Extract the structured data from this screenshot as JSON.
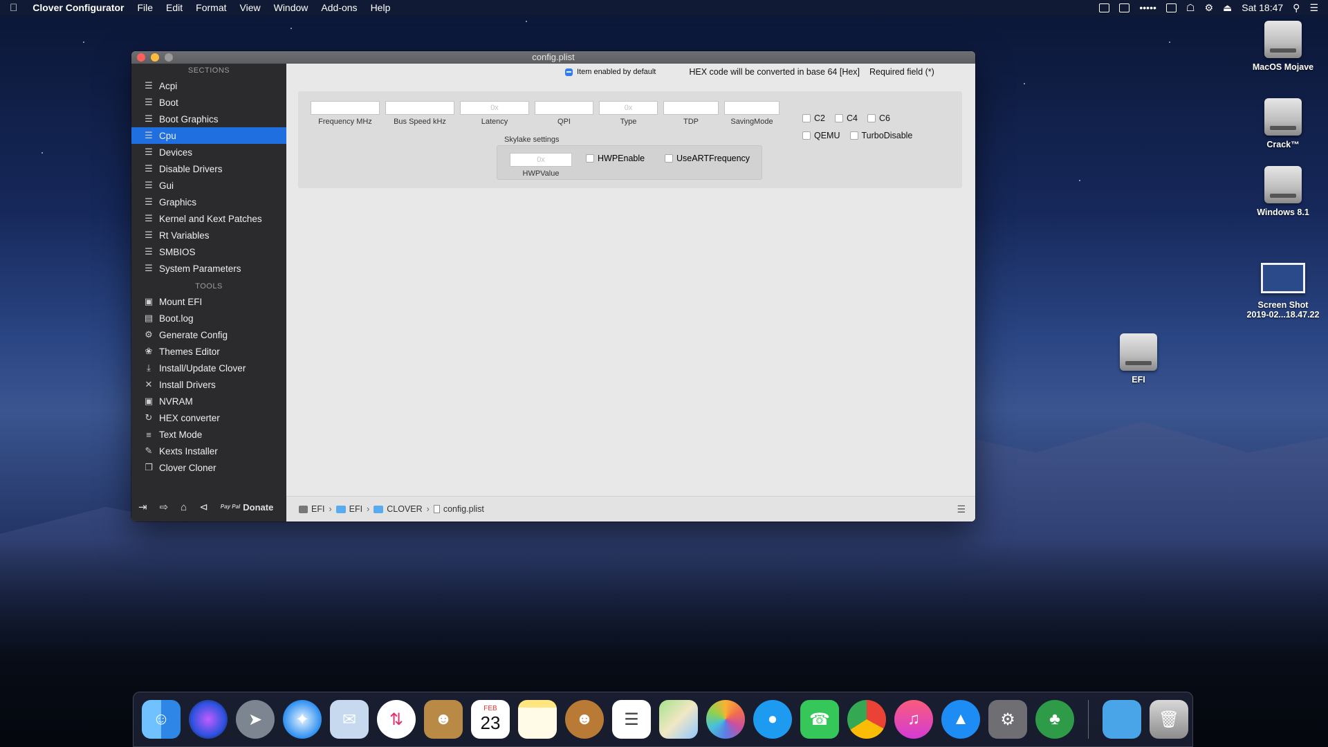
{
  "menubar": {
    "app_name": "Clover Configurator",
    "items": [
      "File",
      "Edit",
      "Format",
      "View",
      "Window",
      "Add-ons",
      "Help"
    ],
    "clock": "Sat 18:47",
    "dots": "•••••"
  },
  "window": {
    "title": "config.plist",
    "sidebar": {
      "sections_heading": "SECTIONS",
      "sections": [
        {
          "label": "Acpi",
          "icon": "list-icon"
        },
        {
          "label": "Boot",
          "icon": "list-icon"
        },
        {
          "label": "Boot Graphics",
          "icon": "list-icon"
        },
        {
          "label": "Cpu",
          "icon": "list-icon",
          "selected": true
        },
        {
          "label": "Devices",
          "icon": "list-icon"
        },
        {
          "label": "Disable Drivers",
          "icon": "list-icon"
        },
        {
          "label": "Gui",
          "icon": "list-icon"
        },
        {
          "label": "Graphics",
          "icon": "list-icon"
        },
        {
          "label": "Kernel and Kext Patches",
          "icon": "list-icon"
        },
        {
          "label": "Rt Variables",
          "icon": "list-icon"
        },
        {
          "label": "SMBIOS",
          "icon": "list-icon"
        },
        {
          "label": "System Parameters",
          "icon": "list-icon"
        }
      ],
      "tools_heading": "TOOLS",
      "tools": [
        {
          "label": "Mount EFI",
          "icon": "disk-icon"
        },
        {
          "label": "Boot.log",
          "icon": "log-icon"
        },
        {
          "label": "Generate Config",
          "icon": "gears-icon"
        },
        {
          "label": "Themes Editor",
          "icon": "palette-icon"
        },
        {
          "label": "Install/Update Clover",
          "icon": "download-icon"
        },
        {
          "label": "Install Drivers",
          "icon": "tools-icon"
        },
        {
          "label": "NVRAM",
          "icon": "chip-icon"
        },
        {
          "label": "HEX converter",
          "icon": "refresh-icon"
        },
        {
          "label": "Text Mode",
          "icon": "text-icon"
        },
        {
          "label": "Kexts Installer",
          "icon": "puzzle-icon"
        },
        {
          "label": "Clover Cloner",
          "icon": "clone-icon"
        }
      ],
      "donate_label": "Donate",
      "paypal_text": "Pay Pal"
    },
    "main": {
      "item_enabled_label": "Item enabled by default",
      "hex_note": "HEX code will be converted in base 64 [Hex]",
      "required_note": "Required field (*)",
      "fields": [
        {
          "label": "Frequency MHz",
          "value": "",
          "placeholder": ""
        },
        {
          "label": "Bus Speed kHz",
          "value": "",
          "placeholder": ""
        },
        {
          "label": "Latency",
          "value": "",
          "placeholder": "0x"
        },
        {
          "label": "QPI",
          "value": "",
          "placeholder": ""
        },
        {
          "label": "Type",
          "value": "",
          "placeholder": "0x"
        },
        {
          "label": "TDP",
          "value": "",
          "placeholder": ""
        },
        {
          "label": "SavingMode",
          "value": "",
          "placeholder": ""
        }
      ],
      "checkboxes": {
        "c2": "C2",
        "c4": "C4",
        "c6": "C6",
        "qemu": "QEMU",
        "turbo_disable": "TurboDisable"
      },
      "skylake": {
        "title": "Skylake settings",
        "hwp_value_label": "HWPValue",
        "hwp_value_placeholder": "0x",
        "hwp_enable": "HWPEnable",
        "use_art_frequency": "UseARTFrequency"
      },
      "pathbar": [
        "EFI",
        "EFI",
        "CLOVER",
        "config.plist"
      ]
    }
  },
  "desktop_icons": [
    {
      "label": "MacOS Mojave",
      "icon": "hard-drive-icon"
    },
    {
      "label": "Crack™",
      "icon": "hard-drive-icon"
    },
    {
      "label": "Windows 8.1",
      "icon": "hard-drive-icon"
    },
    {
      "label": "Screen Shot\n2019-02...18.47.22",
      "line1": "Screen Shot",
      "line2": "2019-02...18.47.22",
      "icon": "screenshot-icon"
    },
    {
      "label": "EFI",
      "icon": "hard-drive-icon"
    }
  ],
  "dock": {
    "calendar_month": "FEB",
    "calendar_day": "23",
    "apps": [
      "Finder",
      "Siri",
      "Launchpad",
      "Safari",
      "Mail",
      "Transmit",
      "Contacts",
      "Calendar",
      "Notes",
      "TunnelBear",
      "Reminders",
      "Maps",
      "Photos",
      "Messages",
      "FaceTime",
      "Chrome",
      "iTunes",
      "App Store",
      "System Preferences",
      "Clover Configurator",
      "Downloads",
      "Trash"
    ]
  }
}
